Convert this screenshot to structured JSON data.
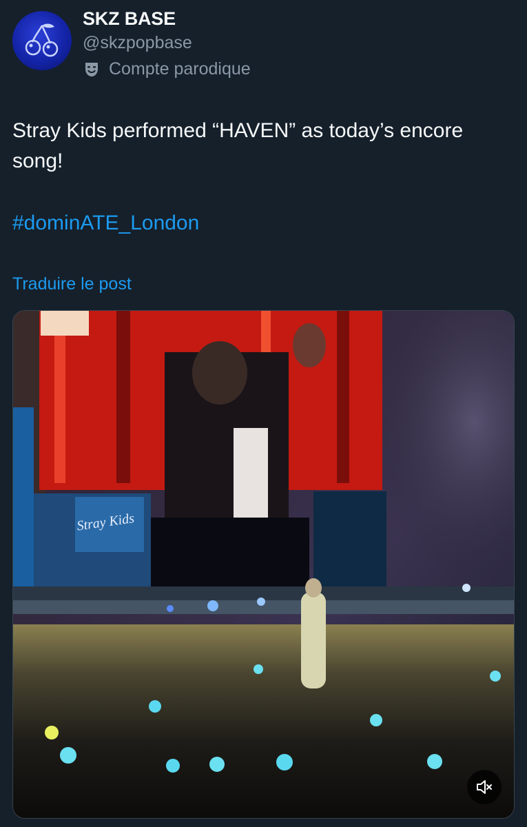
{
  "author": {
    "display_name": "SKZ BASE",
    "handle": "@skzpopbase",
    "label": "Compte parodique",
    "label_icon": "theater-mask-icon",
    "avatar_icon": "cherries-icon"
  },
  "tweet": {
    "text": "Stray Kids performed “HAVEN” as today’s encore song!",
    "hashtag": "#dominATE_London",
    "translate_link": "Traduire le post"
  },
  "media": {
    "type": "video",
    "screen_sign_text": "Stray Kids",
    "mute_icon": "speaker-muted-icon"
  },
  "colors": {
    "background": "#15202b",
    "text_primary": "#f7f9f9",
    "text_secondary": "#8b98a5",
    "link": "#1d9bf0"
  }
}
